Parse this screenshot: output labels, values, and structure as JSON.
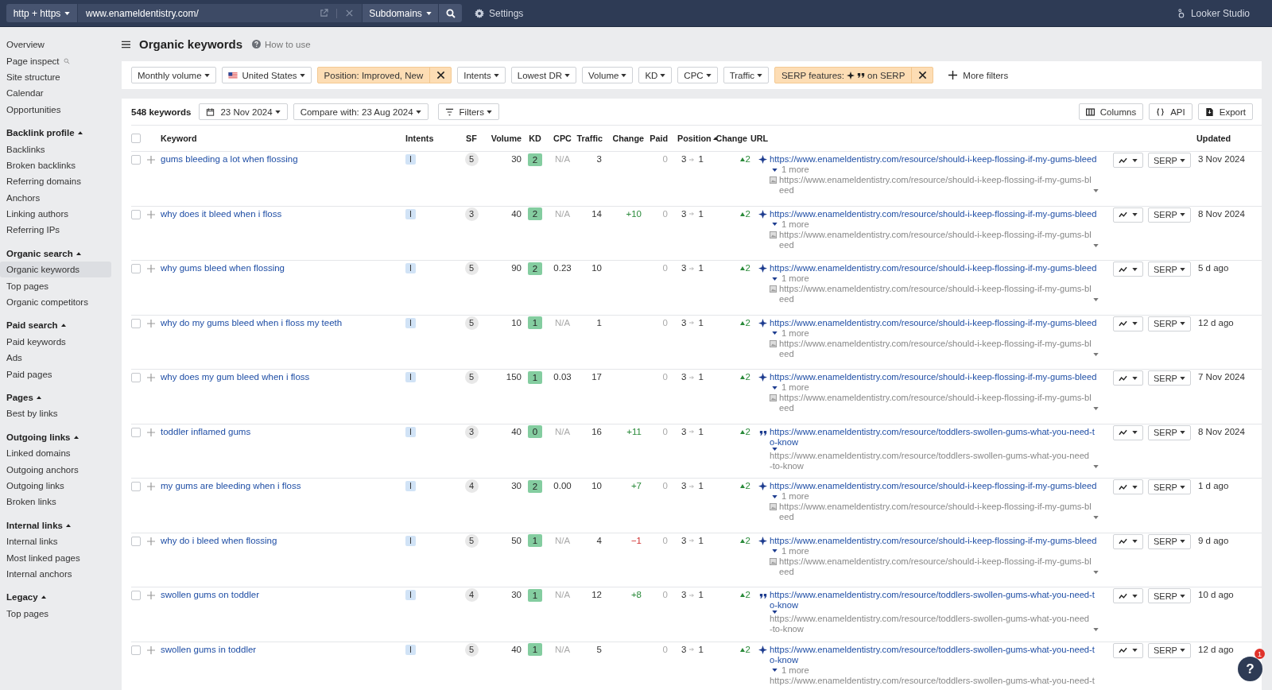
{
  "topbar": {
    "protocol": "http + https",
    "url": "www.enameldentistry.com/",
    "mode": "Subdomains",
    "settings": "Settings",
    "looker": "Looker Studio"
  },
  "page": {
    "title": "Organic keywords",
    "help": "How to use"
  },
  "sidebar": [
    {
      "items": [
        {
          "label": "Overview",
          "kind": "plain",
          "selected": false
        },
        {
          "label": "Page inspect",
          "kind": "inspect",
          "selected": false
        },
        {
          "label": "Site structure",
          "kind": "plain",
          "selected": false
        },
        {
          "label": "Calendar",
          "kind": "plain",
          "selected": false
        },
        {
          "label": "Opportunities",
          "kind": "plain",
          "selected": false
        }
      ]
    },
    {
      "title": "Backlink profile",
      "expanded": true,
      "items": [
        {
          "label": "Backlinks",
          "kind": "plain",
          "selected": false
        },
        {
          "label": "Broken backlinks",
          "kind": "plain",
          "selected": false
        },
        {
          "label": "Referring domains",
          "kind": "plain",
          "selected": false
        },
        {
          "label": "Anchors",
          "kind": "plain",
          "selected": false
        },
        {
          "label": "Linking authors",
          "kind": "plain",
          "selected": false
        },
        {
          "label": "Referring IPs",
          "kind": "plain",
          "selected": false
        }
      ]
    },
    {
      "title": "Organic search",
      "expanded": true,
      "items": [
        {
          "label": "Organic keywords",
          "kind": "plain",
          "selected": true
        },
        {
          "label": "Top pages",
          "kind": "plain",
          "selected": false
        },
        {
          "label": "Organic competitors",
          "kind": "plain",
          "selected": false
        }
      ]
    },
    {
      "title": "Paid search",
      "expanded": true,
      "items": [
        {
          "label": "Paid keywords",
          "kind": "plain",
          "selected": false
        },
        {
          "label": "Ads",
          "kind": "plain",
          "selected": false
        },
        {
          "label": "Paid pages",
          "kind": "plain",
          "selected": false
        }
      ]
    },
    {
      "title": "Pages",
      "expanded": true,
      "items": [
        {
          "label": "Best by links",
          "kind": "plain",
          "selected": false
        }
      ]
    },
    {
      "title": "Outgoing links",
      "expanded": true,
      "items": [
        {
          "label": "Linked domains",
          "kind": "plain",
          "selected": false
        },
        {
          "label": "Outgoing anchors",
          "kind": "plain",
          "selected": false
        },
        {
          "label": "Outgoing links",
          "kind": "plain",
          "selected": false
        },
        {
          "label": "Broken links",
          "kind": "plain",
          "selected": false
        }
      ]
    },
    {
      "title": "Internal links",
      "expanded": true,
      "items": [
        {
          "label": "Internal links",
          "kind": "plain",
          "selected": false
        },
        {
          "label": "Most linked pages",
          "kind": "plain",
          "selected": false
        },
        {
          "label": "Internal anchors",
          "kind": "plain",
          "selected": false
        }
      ]
    },
    {
      "title": "Legacy",
      "expanded": true,
      "items": [
        {
          "label": "Top pages",
          "kind": "plain",
          "selected": false
        }
      ]
    }
  ],
  "filters": [
    {
      "kind": "dropdown",
      "label": "Monthly volume"
    },
    {
      "kind": "country",
      "label": "United States"
    },
    {
      "kind": "applied",
      "label": "Position: Improved, New"
    },
    {
      "kind": "dropdown",
      "label": "Intents"
    },
    {
      "kind": "dropdown",
      "label": "Lowest DR"
    },
    {
      "kind": "dropdown",
      "label": "Volume"
    },
    {
      "kind": "dropdown",
      "label": "KD"
    },
    {
      "kind": "dropdown",
      "label": "CPC"
    },
    {
      "kind": "dropdown",
      "label": "Traffic"
    },
    {
      "kind": "applied-serp",
      "label": "SERP features:",
      "suffix": "on SERP"
    }
  ],
  "more_filters": "More filters",
  "toolbar": {
    "count": "548 keywords",
    "date": "23 Nov 2024",
    "compare": "Compare with: 23 Aug 2024",
    "filters": "Filters",
    "actions": [
      {
        "kind": "columns",
        "label": "Columns"
      },
      {
        "kind": "api",
        "label": "API"
      },
      {
        "kind": "export",
        "label": "Export"
      }
    ]
  },
  "table": {
    "select_all": false,
    "columns": [
      {
        "label": "Keyword",
        "sorted": false
      },
      {
        "label": "Intents",
        "sorted": false
      },
      {
        "label": "SF",
        "sorted": false
      },
      {
        "label": "Volume",
        "sorted": false
      },
      {
        "label": "KD",
        "sorted": false
      },
      {
        "label": "CPC",
        "sorted": false
      },
      {
        "label": "Traffic",
        "sorted": false
      },
      {
        "label": "Change",
        "sorted": false
      },
      {
        "label": "Paid",
        "sorted": false
      },
      {
        "label": "Position",
        "sorted": true
      },
      {
        "label": "Change",
        "sorted": false
      },
      {
        "label": "URL",
        "sorted": false
      },
      {
        "label": "Updated",
        "sorted": false
      }
    ],
    "rows": [
      {
        "checked": false,
        "keyword": "gums bleeding a lot when flossing",
        "intent": "I",
        "sf": "5",
        "volume": "30",
        "kd": "2",
        "cpc": "N/A",
        "cpc_na": true,
        "traffic": "3",
        "paid": "0",
        "pos_from": "3",
        "pos_to": "1",
        "pos_change": "2",
        "url": {
          "kind": "ai",
          "text": "https://www.enameldentistry.com/resource/should-i-keep-flossing-if-my-gums-bleed"
        },
        "more": "1 more",
        "secondary": {
          "text": "https://www.enameldentistry.com/resource/should-i-keep-flossing-if-my-gums-bleed",
          "image": true,
          "caret": true
        },
        "serp": "SERP",
        "updated": "3 Nov 2024"
      },
      {
        "checked": false,
        "keyword": "why does it bleed when i floss",
        "intent": "I",
        "sf": "3",
        "volume": "40",
        "kd": "2",
        "cpc": "N/A",
        "cpc_na": true,
        "traffic": "14",
        "change": {
          "text": "+10",
          "rising": true
        },
        "paid": "0",
        "pos_from": "3",
        "pos_to": "1",
        "pos_change": "2",
        "url": {
          "kind": "ai",
          "text": "https://www.enameldentistry.com/resource/should-i-keep-flossing-if-my-gums-bleed"
        },
        "more": "1 more",
        "secondary": {
          "text": "https://www.enameldentistry.com/resource/should-i-keep-flossing-if-my-gums-bleed",
          "image": true,
          "caret": true
        },
        "serp": "SERP",
        "updated": "8 Nov 2024"
      },
      {
        "checked": false,
        "keyword": "why gums bleed when flossing",
        "intent": "I",
        "sf": "5",
        "volume": "90",
        "kd": "2",
        "cpc": "0.23",
        "cpc_na": false,
        "traffic": "10",
        "paid": "0",
        "pos_from": "3",
        "pos_to": "1",
        "pos_change": "2",
        "url": {
          "kind": "ai",
          "text": "https://www.enameldentistry.com/resource/should-i-keep-flossing-if-my-gums-bleed"
        },
        "more": "1 more",
        "secondary": {
          "text": "https://www.enameldentistry.com/resource/should-i-keep-flossing-if-my-gums-bleed",
          "image": true,
          "caret": true
        },
        "serp": "SERP",
        "updated": "5 d ago"
      },
      {
        "checked": false,
        "keyword": "why do my gums bleed when i floss my teeth",
        "intent": "I",
        "sf": "5",
        "volume": "10",
        "kd": "1",
        "cpc": "N/A",
        "cpc_na": true,
        "traffic": "1",
        "paid": "0",
        "pos_from": "3",
        "pos_to": "1",
        "pos_change": "2",
        "url": {
          "kind": "ai",
          "text": "https://www.enameldentistry.com/resource/should-i-keep-flossing-if-my-gums-bleed"
        },
        "more": "1 more",
        "secondary": {
          "text": "https://www.enameldentistry.com/resource/should-i-keep-flossing-if-my-gums-bleed",
          "image": true,
          "caret": true
        },
        "serp": "SERP",
        "updated": "12 d ago"
      },
      {
        "checked": false,
        "keyword": "why does my gum bleed when i floss",
        "intent": "I",
        "sf": "5",
        "volume": "150",
        "kd": "1",
        "cpc": "0.03",
        "cpc_na": false,
        "traffic": "17",
        "paid": "0",
        "pos_from": "3",
        "pos_to": "1",
        "pos_change": "2",
        "url": {
          "kind": "ai",
          "text": "https://www.enameldentistry.com/resource/should-i-keep-flossing-if-my-gums-bleed"
        },
        "more": "1 more",
        "secondary": {
          "text": "https://www.enameldentistry.com/resource/should-i-keep-flossing-if-my-gums-bleed",
          "image": true,
          "caret": true
        },
        "serp": "SERP",
        "updated": "7 Nov 2024"
      },
      {
        "checked": false,
        "keyword": "toddler inflamed gums",
        "intent": "I",
        "sf": "3",
        "volume": "40",
        "kd": "0",
        "cpc": "N/A",
        "cpc_na": true,
        "traffic": "16",
        "change": {
          "text": "+11",
          "rising": true
        },
        "paid": "0",
        "pos_from": "3",
        "pos_to": "1",
        "pos_change": "2",
        "url": {
          "kind": "quote",
          "text": "https://www.enameldentistry.com/resource/toddlers-swollen-gums-what-you-need-to-know"
        },
        "secondary": {
          "text": "https://www.enameldentistry.com/resource/toddlers-swollen-gums-what-you-need-to-know",
          "image": false,
          "caret": true
        },
        "serp": "SERP",
        "updated": "8 Nov 2024"
      },
      {
        "checked": false,
        "keyword": "my gums are bleeding when i floss",
        "intent": "I",
        "sf": "4",
        "volume": "30",
        "kd": "2",
        "cpc": "0.00",
        "cpc_na": false,
        "traffic": "10",
        "change": {
          "text": "+7",
          "rising": true
        },
        "paid": "0",
        "pos_from": "3",
        "pos_to": "1",
        "pos_change": "2",
        "url": {
          "kind": "ai",
          "text": "https://www.enameldentistry.com/resource/should-i-keep-flossing-if-my-gums-bleed"
        },
        "more": "1 more",
        "secondary": {
          "text": "https://www.enameldentistry.com/resource/should-i-keep-flossing-if-my-gums-bleed",
          "image": true,
          "caret": true
        },
        "serp": "SERP",
        "updated": "1 d ago"
      },
      {
        "checked": false,
        "keyword": "why do i bleed when flossing",
        "intent": "I",
        "sf": "5",
        "volume": "50",
        "kd": "1",
        "cpc": "N/A",
        "cpc_na": true,
        "traffic": "4",
        "change": {
          "text": "−1",
          "rising": false
        },
        "paid": "0",
        "pos_from": "3",
        "pos_to": "1",
        "pos_change": "2",
        "url": {
          "kind": "ai",
          "text": "https://www.enameldentistry.com/resource/should-i-keep-flossing-if-my-gums-bleed"
        },
        "more": "1 more",
        "secondary": {
          "text": "https://www.enameldentistry.com/resource/should-i-keep-flossing-if-my-gums-bleed",
          "image": true,
          "caret": true
        },
        "serp": "SERP",
        "updated": "9 d ago"
      },
      {
        "checked": false,
        "keyword": "swollen gums on toddler",
        "intent": "I",
        "sf": "4",
        "volume": "30",
        "kd": "1",
        "cpc": "N/A",
        "cpc_na": true,
        "traffic": "12",
        "change": {
          "text": "+8",
          "rising": true
        },
        "paid": "0",
        "pos_from": "3",
        "pos_to": "1",
        "pos_change": "2",
        "url": {
          "kind": "quote",
          "text": "https://www.enameldentistry.com/resource/toddlers-swollen-gums-what-you-need-to-know"
        },
        "secondary": {
          "text": "https://www.enameldentistry.com/resource/toddlers-swollen-gums-what-you-need-to-know",
          "image": false,
          "caret": true
        },
        "serp": "SERP",
        "updated": "10 d ago"
      },
      {
        "checked": false,
        "keyword": "swollen gums in toddler",
        "intent": "I",
        "sf": "5",
        "volume": "40",
        "kd": "1",
        "cpc": "N/A",
        "cpc_na": true,
        "traffic": "5",
        "paid": "0",
        "pos_from": "3",
        "pos_to": "1",
        "pos_change": "2",
        "url": {
          "kind": "ai",
          "text": "https://www.enameldentistry.com/resource/toddlers-swollen-gums-what-you-need-to-know"
        },
        "more": "1 more",
        "secondary": {
          "text": "https://www.enameldentistry.com/resource/toddlers-swollen-gums-what-you-need-t",
          "image": false,
          "caret": false
        },
        "serp": "SERP",
        "updated": "12 d ago"
      }
    ]
  },
  "help_button": {
    "label": "?",
    "badge": "1"
  }
}
